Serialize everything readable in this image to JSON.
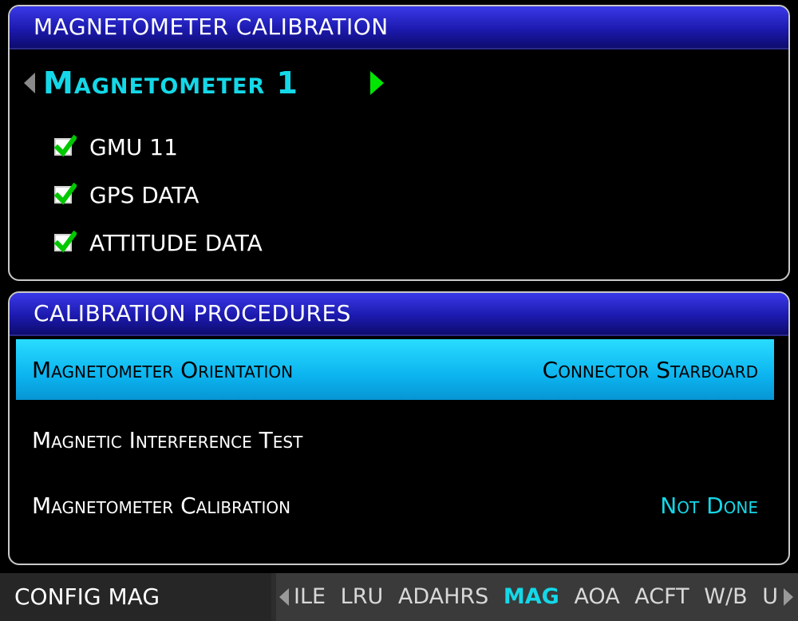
{
  "colors": {
    "accent_cyan": "#14d8e8",
    "check_green": "#00c800",
    "selection_blue": "#0cb4ef",
    "title_blue": "#1c1aae"
  },
  "magnetometer_panel": {
    "title": "MAGNETOMETER CALIBRATION",
    "selector": {
      "label": "Magnetometer 1",
      "prev_icon": "chevron-left-icon",
      "next_icon": "chevron-right-icon"
    },
    "checks": [
      {
        "label": "GMU 11",
        "checked": true
      },
      {
        "label": "GPS DATA",
        "checked": true
      },
      {
        "label": "ATTITUDE DATA",
        "checked": true
      }
    ]
  },
  "procedures_panel": {
    "title": "CALIBRATION PROCEDURES",
    "rows": [
      {
        "label": "Magnetometer Orientation",
        "value": "Connector Starboard",
        "selected": true
      },
      {
        "label": "Magnetic Interference Test",
        "value": "",
        "selected": false
      },
      {
        "label": "Magnetometer Calibration",
        "value": "Not Done",
        "selected": false
      }
    ]
  },
  "footer": {
    "page_label": "CONFIG MAG",
    "tabs": [
      "ILE",
      "LRU",
      "ADAHRS",
      "MAG",
      "AOA",
      "ACFT",
      "W/B",
      "U"
    ],
    "active_tab": "MAG"
  }
}
